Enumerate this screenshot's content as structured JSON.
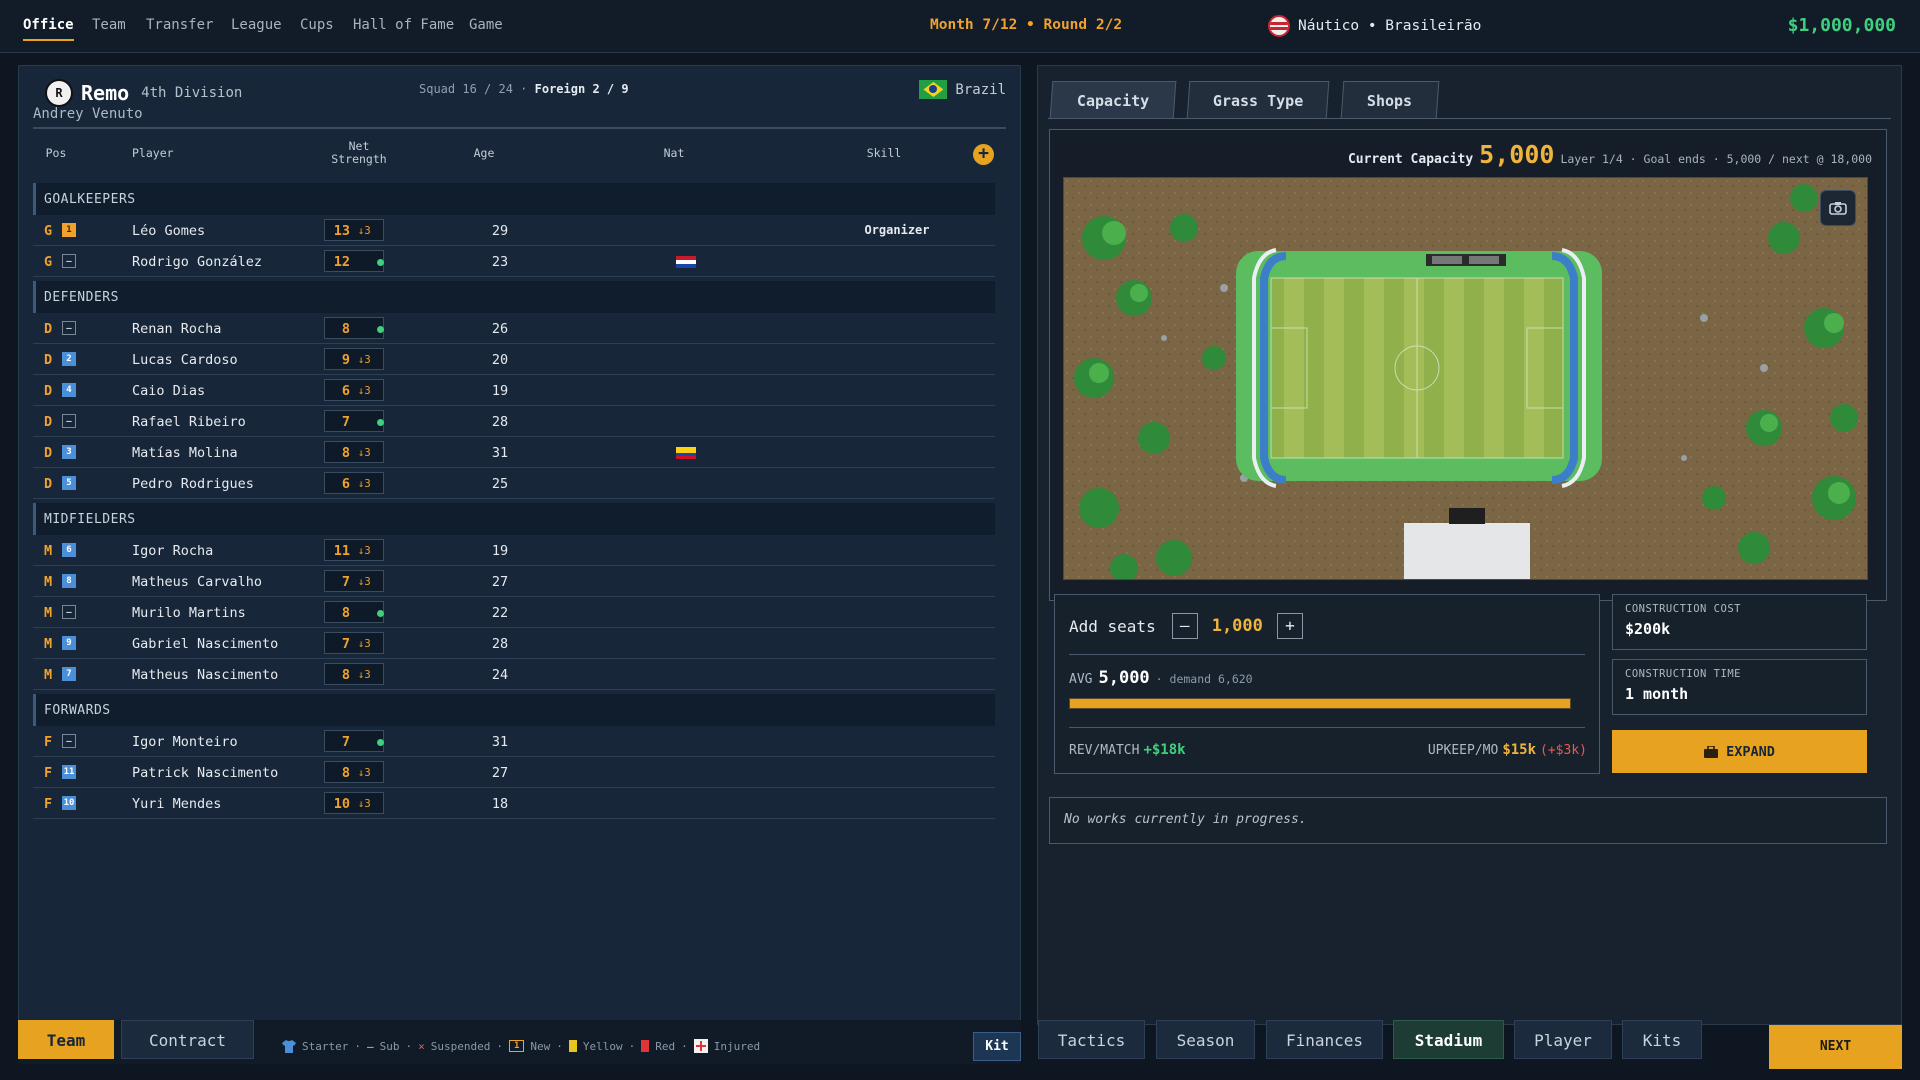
{
  "nav": {
    "items": [
      "Office",
      "Team",
      "Transfer",
      "League",
      "Cups",
      "Hall of Fame",
      "Game"
    ],
    "active": "Office"
  },
  "status": {
    "season": "Month 7/12 • Round 2/2",
    "club_line": "Náutico • Brasileirão",
    "cash": "$1,000,000"
  },
  "team": {
    "crest_letter": "R",
    "name": "Remo",
    "division": "4th Division",
    "manager": "Andrey Venuto",
    "squad_label": "Squad",
    "squad": "16 / 24",
    "foreign_label": "Foreign",
    "foreign": "2 / 9",
    "country": "Brazil"
  },
  "columns": {
    "pos": "Pos",
    "player": "Player",
    "net1": "Net",
    "net2": "Strength",
    "age": "Age",
    "nat": "Nat",
    "skill": "Skill",
    "add": "+"
  },
  "roster": [
    {
      "section": "GOALKEEPERS",
      "players": [
        {
          "pos": "G",
          "shirt": "1",
          "shirt_type": "gk",
          "name": "Léo Gomes",
          "strength": "13",
          "trend": "↓3",
          "age": "29",
          "nat": "",
          "skill": "Organizer"
        },
        {
          "pos": "G",
          "shirt": "–",
          "shirt_type": "none",
          "name": "Rodrigo González",
          "strength": "12",
          "trend": "dot",
          "age": "23",
          "nat": "paraguay",
          "skill": ""
        }
      ]
    },
    {
      "section": "DEFENDERS",
      "players": [
        {
          "pos": "D",
          "shirt": "–",
          "shirt_type": "none",
          "name": "Renan Rocha",
          "strength": "8",
          "trend": "dot",
          "age": "26",
          "nat": "",
          "skill": ""
        },
        {
          "pos": "D",
          "shirt": "2",
          "shirt_type": "field",
          "name": "Lucas Cardoso",
          "strength": "9",
          "trend": "↓3",
          "age": "20",
          "nat": "",
          "skill": ""
        },
        {
          "pos": "D",
          "shirt": "4",
          "shirt_type": "field",
          "name": "Caio Dias",
          "strength": "6",
          "trend": "↓3",
          "age": "19",
          "nat": "",
          "skill": ""
        },
        {
          "pos": "D",
          "shirt": "–",
          "shirt_type": "none",
          "name": "Rafael Ribeiro",
          "strength": "7",
          "trend": "dot",
          "age": "28",
          "nat": "",
          "skill": ""
        },
        {
          "pos": "D",
          "shirt": "3",
          "shirt_type": "field",
          "name": "Matías Molina",
          "strength": "8",
          "trend": "↓3",
          "age": "31",
          "nat": "colombia",
          "skill": ""
        },
        {
          "pos": "D",
          "shirt": "5",
          "shirt_type": "field",
          "name": "Pedro Rodrigues",
          "strength": "6",
          "trend": "↓3",
          "age": "25",
          "nat": "",
          "skill": ""
        }
      ]
    },
    {
      "section": "MIDFIELDERS",
      "players": [
        {
          "pos": "M",
          "shirt": "6",
          "shirt_type": "field",
          "name": "Igor Rocha",
          "strength": "11",
          "trend": "↓3",
          "age": "19",
          "nat": "",
          "skill": ""
        },
        {
          "pos": "M",
          "shirt": "8",
          "shirt_type": "field",
          "name": "Matheus Carvalho",
          "strength": "7",
          "trend": "↓3",
          "age": "27",
          "nat": "",
          "skill": ""
        },
        {
          "pos": "M",
          "shirt": "–",
          "shirt_type": "none",
          "name": "Murilo Martins",
          "strength": "8",
          "trend": "dot",
          "age": "22",
          "nat": "",
          "skill": ""
        },
        {
          "pos": "M",
          "shirt": "9",
          "shirt_type": "field",
          "name": "Gabriel Nascimento",
          "strength": "7",
          "trend": "↓3",
          "age": "28",
          "nat": "",
          "skill": ""
        },
        {
          "pos": "M",
          "shirt": "7",
          "shirt_type": "field",
          "name": "Matheus Nascimento",
          "strength": "8",
          "trend": "↓3",
          "age": "24",
          "nat": "",
          "skill": ""
        }
      ]
    },
    {
      "section": "FORWARDS",
      "players": [
        {
          "pos": "F",
          "shirt": "–",
          "shirt_type": "none",
          "name": "Igor Monteiro",
          "strength": "7",
          "trend": "dot",
          "age": "31",
          "nat": "",
          "skill": ""
        },
        {
          "pos": "F",
          "shirt": "11",
          "shirt_type": "field",
          "name": "Patrick Nascimento",
          "strength": "8",
          "trend": "↓3",
          "age": "27",
          "nat": "",
          "skill": ""
        },
        {
          "pos": "F",
          "shirt": "10",
          "shirt_type": "field",
          "name": "Yuri Mendes",
          "strength": "10",
          "trend": "↓3",
          "age": "18",
          "nat": "",
          "skill": ""
        }
      ]
    }
  ],
  "left_tabs": {
    "team": "Team",
    "contract": "Contract",
    "kit": "Kit"
  },
  "legend": {
    "starter": "Starter",
    "sub_symbol": "–",
    "sub": "Sub",
    "suspended_symbol": "×",
    "suspended": "Suspended",
    "new_symbol": "1",
    "new": "New",
    "yellow": "Yellow",
    "red": "Red",
    "injured": "Injured",
    "sep": "·"
  },
  "stadium": {
    "tabs": [
      "Capacity",
      "Grass Type",
      "Shops"
    ],
    "active_tab": "Capacity",
    "capacity_label": "Current Capacity",
    "capacity": "5,000",
    "capacity_note": "Layer 1/4 · Goal ends · 5,000 / next @ 18,000",
    "add_seats_label": "Add seats",
    "minus": "–",
    "plus": "+",
    "add_seats_value": "1,000",
    "avg_label": "AVG",
    "avg_value": "5,000",
    "demand": "· demand 6,620",
    "demand_fill": 1.0,
    "rev_label": "REV/MATCH",
    "rev_value": "+$18k",
    "upkeep_label": "UPKEEP/MO",
    "upkeep_value": "$15k",
    "upkeep_delta": "(+$3k)",
    "cost_label": "CONSTRUCTION COST",
    "cost_value": "$200k",
    "time_label": "CONSTRUCTION TIME",
    "time_value": "1 month",
    "expand_label": "EXPAND",
    "works_status": "No works currently in progress."
  },
  "bottom_tabs": [
    "Tactics",
    "Season",
    "Finances",
    "Stadium",
    "Player",
    "Kits"
  ],
  "bottom_active": "Stadium",
  "next_label": "NEXT",
  "colors": {
    "accent": "#e7a31f",
    "positive": "#3fd07f",
    "negative": "#ec5a4b",
    "panel": "#172638"
  }
}
